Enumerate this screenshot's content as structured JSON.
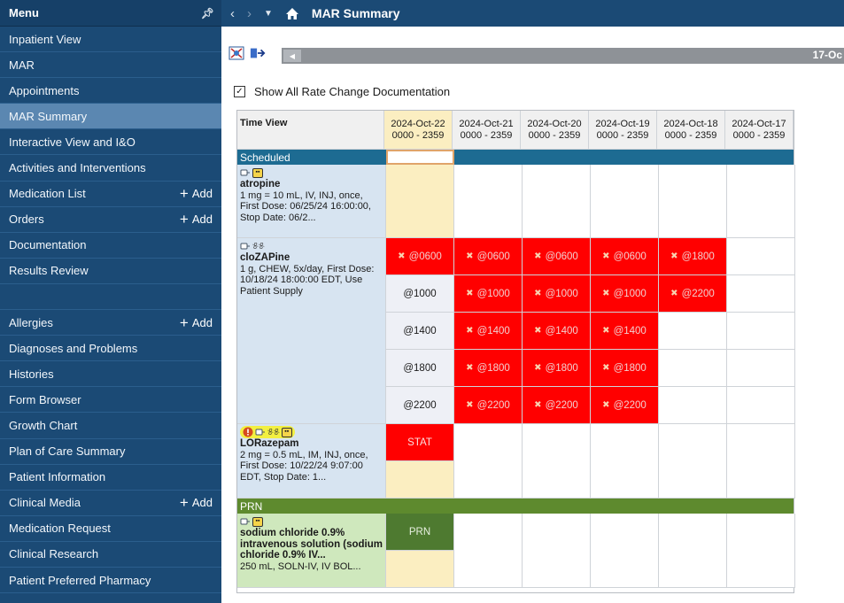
{
  "sidebar": {
    "title": "Menu",
    "items": [
      {
        "label": "Inpatient View"
      },
      {
        "label": "MAR"
      },
      {
        "label": "Appointments"
      },
      {
        "label": "MAR Summary",
        "active": true
      },
      {
        "label": "Interactive View and I&O"
      },
      {
        "label": "Activities and Interventions"
      },
      {
        "label": "Medication List",
        "add": "Add"
      },
      {
        "label": "Orders",
        "add": "Add"
      },
      {
        "label": "Documentation"
      },
      {
        "label": "Results Review"
      },
      {
        "label": ""
      },
      {
        "label": "Allergies",
        "add": "Add"
      },
      {
        "label": "Diagnoses and Problems"
      },
      {
        "label": "Histories"
      },
      {
        "label": "Form Browser"
      },
      {
        "label": "Growth Chart"
      },
      {
        "label": "Plan of Care Summary"
      },
      {
        "label": "Patient Information"
      },
      {
        "label": "Clinical Media",
        "add": "Add"
      },
      {
        "label": "Medication Request"
      },
      {
        "label": "Clinical Research"
      },
      {
        "label": "Patient Preferred Pharmacy"
      }
    ]
  },
  "titlebar": {
    "title": "MAR Summary"
  },
  "toolbar": {
    "date_range": "17-Oc"
  },
  "show_all": {
    "label": "Show All Rate Change Documentation",
    "checked": true
  },
  "grid": {
    "time_view_label": "Time View",
    "columns": [
      {
        "date": "2024-Oct-22",
        "range": "0000 - 2359"
      },
      {
        "date": "2024-Oct-21",
        "range": "0000 - 2359"
      },
      {
        "date": "2024-Oct-20",
        "range": "0000 - 2359"
      },
      {
        "date": "2024-Oct-19",
        "range": "0000 - 2359"
      },
      {
        "date": "2024-Oct-18",
        "range": "0000 - 2359"
      },
      {
        "date": "2024-Oct-17",
        "range": "0000 - 2359"
      }
    ],
    "scheduled_label": "Scheduled",
    "prn_label": "PRN",
    "colors": {
      "scheduled": "#1d6b92",
      "prn": "#5e8a2e",
      "red": "#ff0000",
      "tan": "#fbeec1"
    },
    "meds": {
      "atropine": {
        "name": "atropine",
        "details": "1 mg = 10 mL, IV, INJ, once, First Dose: 06/25/24 16:00:00, Stop Date: 06/2..."
      },
      "clozapine": {
        "name": "cloZAPine",
        "details": "1 g, CHEW, 5x/day, First Dose: 10/18/24 18:00:00 EDT, Use Patient Supply",
        "rows": [
          [
            "@0600",
            "@0600",
            "@0600",
            "@0600",
            "@1800"
          ],
          [
            "@1000",
            "@1000",
            "@1000",
            "@1000",
            "@2200"
          ],
          [
            "@1400",
            "@1400",
            "@1400",
            "@1400"
          ],
          [
            "@1800",
            "@1800",
            "@1800",
            "@1800"
          ],
          [
            "@2200",
            "@2200",
            "@2200",
            "@2200"
          ]
        ]
      },
      "lorazepam": {
        "name": "LORazepam",
        "details": "2 mg = 0.5 mL, IM, INJ, once, First Dose: 10/22/24 9:07:00 EDT, Stop Date: 1...",
        "first_cell": "STAT"
      },
      "sodium": {
        "name": "sodium chloride 0.9% intravenous solution (sodium chloride 0.9% IV...",
        "details": "250 mL, SOLN-IV, IV BOL...",
        "first_cell": "PRN"
      }
    }
  }
}
